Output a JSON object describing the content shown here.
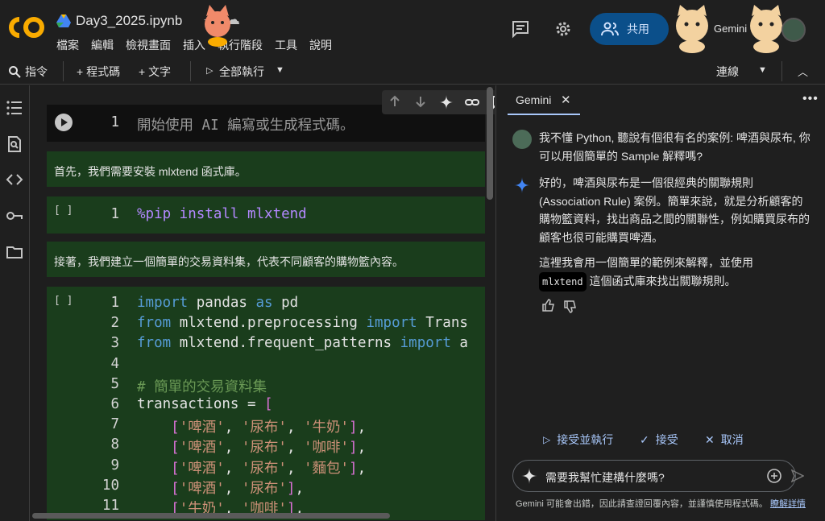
{
  "header": {
    "title": "Day3_2025.ipynb",
    "menu": [
      "檔案",
      "編輯",
      "檢視畫面",
      "插入",
      "執行階段",
      "工具",
      "說明"
    ],
    "share_label": "共用",
    "gemini_label": "Gemini",
    "logo_text": "CO"
  },
  "toolbar": {
    "commands_label": "指令",
    "add_code_label": "+ 程式碼",
    "add_text_label": "+ 文字",
    "run_all_label": "全部執行",
    "connect_label": "連線"
  },
  "notebook": {
    "cell1": {
      "line_no": "1",
      "text": "開始使用 AI 編寫或生成程式碼。"
    },
    "text1": "首先，我們需要安裝 mlxtend 函式庫。",
    "cell2": {
      "bracket": "[ ]",
      "line_no": "1",
      "code": "%pip install mlxtend"
    },
    "text2": "接著，我們建立一個簡單的交易資料集，代表不同顧客的購物籃內容。",
    "cell3": {
      "bracket": "[ ]",
      "lines": [
        {
          "n": "1",
          "code": "import pandas as pd"
        },
        {
          "n": "2",
          "code": "from mlxtend.preprocessing import Trans"
        },
        {
          "n": "3",
          "code": "from mlxtend.frequent_patterns import a"
        },
        {
          "n": "4",
          "code": ""
        },
        {
          "n": "5",
          "code": "# 簡單的交易資料集"
        },
        {
          "n": "6",
          "code": "transactions = ["
        },
        {
          "n": "7",
          "code": "    ['啤酒', '尿布', '牛奶'],"
        },
        {
          "n": "8",
          "code": "    ['啤酒', '尿布', '咖啡'],"
        },
        {
          "n": "9",
          "code": "    ['啤酒', '尿布', '麵包'],"
        },
        {
          "n": "10",
          "code": "    ['啤酒', '尿布'],"
        },
        {
          "n": "11",
          "code": "    ['牛奶', '咖啡'],"
        }
      ]
    }
  },
  "panel": {
    "tab_label": "Gemini",
    "user_msg": "我不懂 Python, 聽說有個很有名的案例: 啤酒與尿布, 你可以用個簡單的 Sample 解釋嗎?",
    "reply_p1": "好的，啤酒與尿布是一個很經典的關聯規則 (Association Rule) 案例。簡單來說，就是分析顧客的購物籃資料，找出商品之間的關聯性，例如購買尿布的顧客也很可能購買啤酒。",
    "reply_p2_pre": "這裡我會用一個簡單的範例來解釋，並使用",
    "reply_p2_code": "mlxtend",
    "reply_p2_post": "這個函式庫來找出關聯規則。",
    "accept_run_label": "接受並執行",
    "accept_label": "接受",
    "cancel_label": "取消",
    "input_placeholder": "需要我幫忙建構什麼嗎?",
    "disclaimer": "Gemini 可能會出錯，因此請查證回覆內容，並謹慎使用程式碼。",
    "learn_more": "瞭解詳情"
  },
  "colors": {
    "cell_bg": "#1a3d1c",
    "accent": "#a8c7fa",
    "share_bg": "#0b4f8a"
  }
}
